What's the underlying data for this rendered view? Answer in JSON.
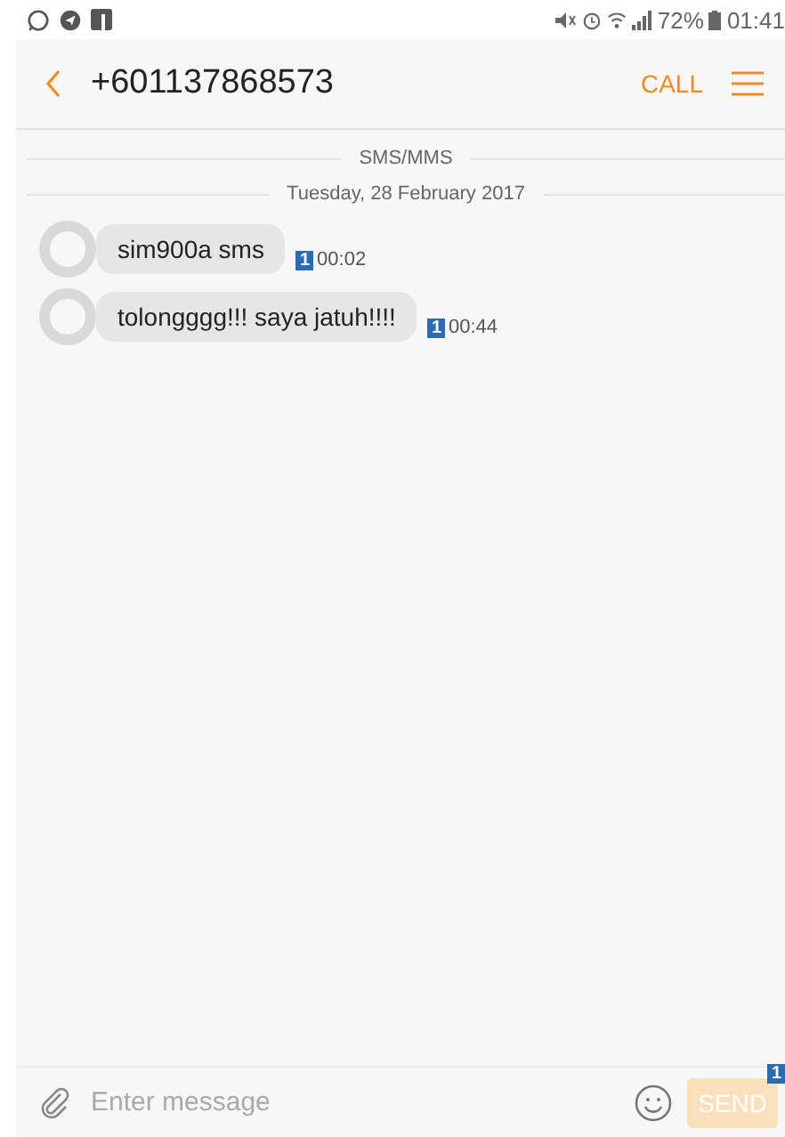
{
  "status_bar": {
    "battery": "72%",
    "time": "01:41"
  },
  "header": {
    "title": "+601137868573",
    "call": "CALL"
  },
  "channel_label": "SMS/MMS",
  "date_label": "Tuesday, 28 February 2017",
  "messages": [
    {
      "text": "sim900a sms",
      "sim": "1",
      "time": "00:02"
    },
    {
      "text": "tolongggg!!! saya jatuh!!!!",
      "sim": "1",
      "time": "00:44"
    }
  ],
  "composer": {
    "placeholder": "Enter message",
    "send": "SEND",
    "send_disabled": true,
    "sim": "1"
  }
}
